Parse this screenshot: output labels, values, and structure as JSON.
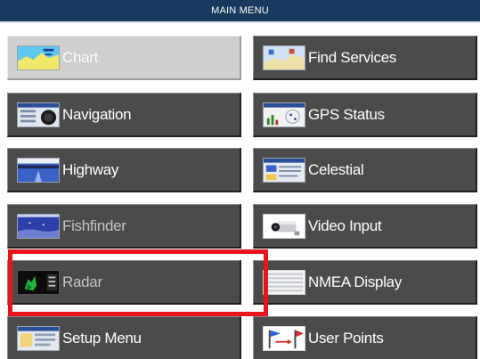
{
  "header": {
    "title": "MAIN MENU"
  },
  "menu": {
    "left": [
      {
        "label": "Chart",
        "icon": "chart-thumbnail-icon",
        "state": "selected"
      },
      {
        "label": "Navigation",
        "icon": "navigation-thumbnail-icon",
        "state": "normal"
      },
      {
        "label": "Highway",
        "icon": "highway-thumbnail-icon",
        "state": "normal"
      },
      {
        "label": "Fishfinder",
        "icon": "fishfinder-thumbnail-icon",
        "state": "dimmed"
      },
      {
        "label": "Radar",
        "icon": "radar-thumbnail-icon",
        "state": "dimmed"
      },
      {
        "label": "Setup Menu",
        "icon": "setup-menu-thumbnail-icon",
        "state": "normal"
      }
    ],
    "right": [
      {
        "label": "Find Services",
        "icon": "find-services-thumbnail-icon",
        "state": "normal"
      },
      {
        "label": "GPS Status",
        "icon": "gps-status-thumbnail-icon",
        "state": "normal"
      },
      {
        "label": "Celestial",
        "icon": "celestial-thumbnail-icon",
        "state": "normal"
      },
      {
        "label": "Video Input",
        "icon": "video-camera-icon",
        "state": "normal"
      },
      {
        "label": "NMEA Display",
        "icon": "nmea-display-thumbnail-icon",
        "state": "normal"
      },
      {
        "label": "User Points",
        "icon": "user-points-flags-icon",
        "state": "normal"
      }
    ]
  },
  "colors": {
    "header_bg": "#173a5e",
    "button_bg": "#4b4b4b",
    "selected_bg": "#cfcfcf",
    "highlight_border": "#e8151b"
  }
}
